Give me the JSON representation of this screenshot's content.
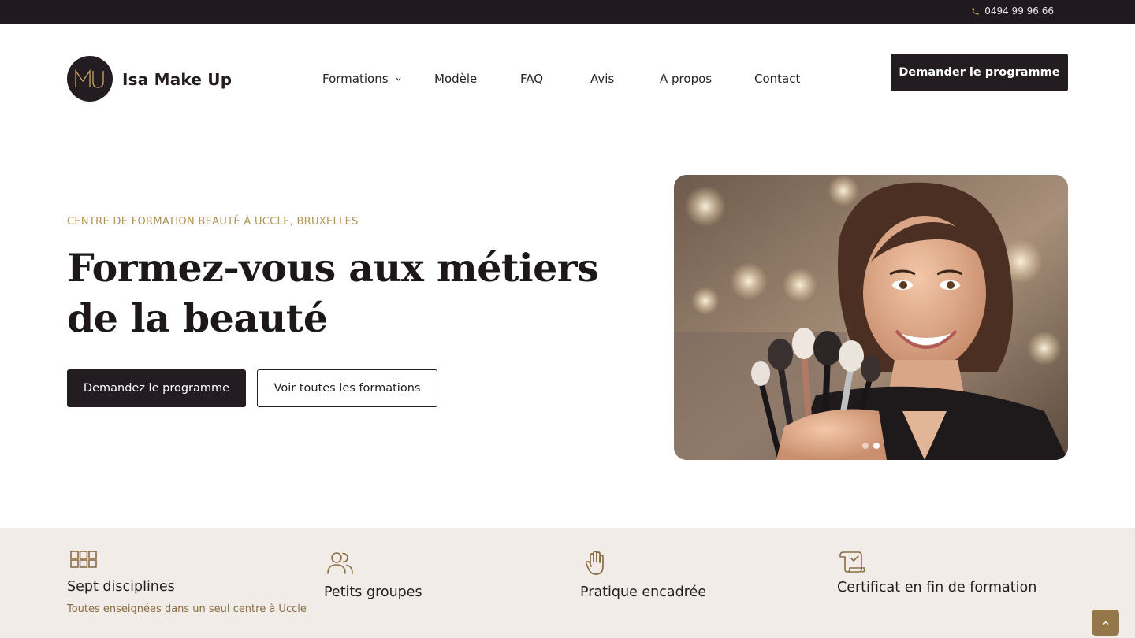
{
  "topbar": {
    "phone": "0494 99 96 66"
  },
  "header": {
    "brand_name": "Isa Make Up",
    "cta_label": "Demander le programme"
  },
  "nav": {
    "items": [
      {
        "label": "Formations",
        "has_dropdown": true
      },
      {
        "label": "Modèle"
      },
      {
        "label": "FAQ"
      },
      {
        "label": "Avis"
      },
      {
        "label": "A propos"
      },
      {
        "label": "Contact"
      }
    ]
  },
  "hero": {
    "eyebrow": "CENTRE DE FORMATION BEAUTÉ À UCCLE, BRUXELLES",
    "title": "Formez-vous aux métiers de la beauté",
    "primary_button": "Demandez le programme",
    "secondary_button": "Voir toutes les formations",
    "carousel": {
      "slides": 2,
      "active": 2
    }
  },
  "features": [
    {
      "icon": "grid-icon",
      "title": "Sept disciplines",
      "desc": "Toutes enseignées dans un seul centre à Uccle"
    },
    {
      "icon": "users-icon",
      "title": "Petits groupes",
      "desc": ""
    },
    {
      "icon": "hand-icon",
      "title": "Pratique encadrée",
      "desc": ""
    },
    {
      "icon": "certificate-icon",
      "title": "Certificat en fin de formation",
      "desc": ""
    }
  ],
  "colors": {
    "dark": "#231c20",
    "accent_gold": "#b09456",
    "features_bg": "#f2ece8",
    "to_top_button": "#94784a"
  }
}
